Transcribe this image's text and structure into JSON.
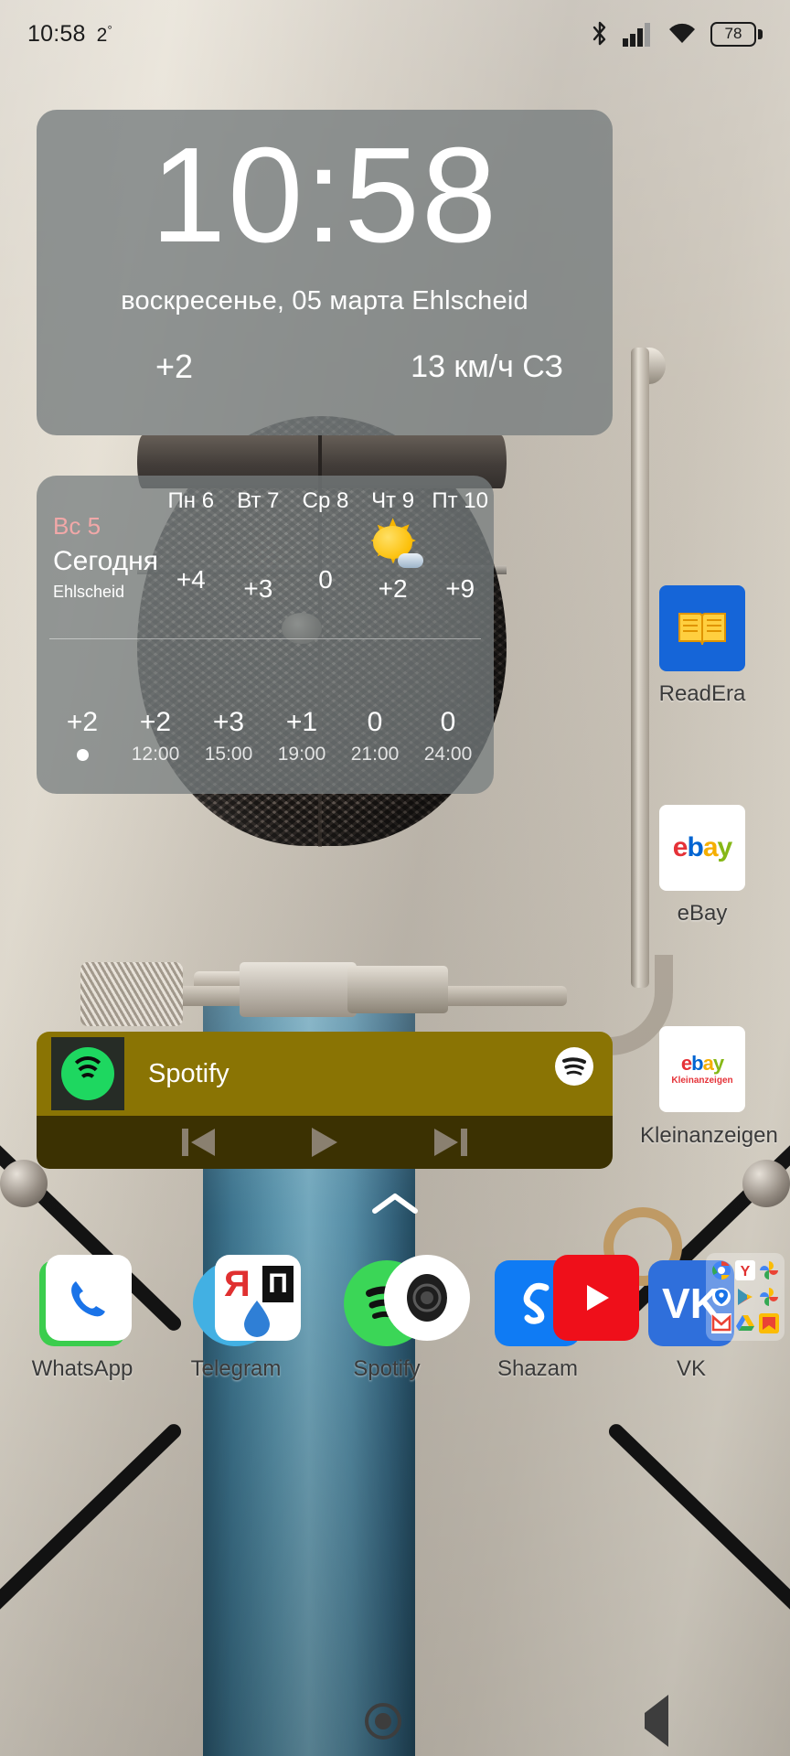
{
  "status_bar": {
    "time": "10:58",
    "temperature": "2",
    "degree": "°",
    "battery_level": "78",
    "icons": [
      "bluetooth-icon",
      "cellular-signal-icon",
      "wifi-icon",
      "battery-icon"
    ]
  },
  "clock_widget": {
    "time": "10:58",
    "date": "воскресенье, 05 марта Ehlscheid",
    "weather_icon": "rain-cloud-icon",
    "temperature": "+2",
    "wind": "13 км/ч СЗ"
  },
  "weather_widget": {
    "today_day": "Вс 5",
    "today_label": "Сегодня",
    "city": "Ehlscheid",
    "days": [
      {
        "label": "Пн 6",
        "icon": "cloud-icon",
        "temp": "+4"
      },
      {
        "label": "Вт 7",
        "icon": "rain-cloud-icon",
        "temp": "+3"
      },
      {
        "label": "Ср 8",
        "icon": "cloud-icon",
        "temp": "0"
      },
      {
        "label": "Чт 9",
        "icon": "sun-cloud-icon",
        "temp": "+2"
      },
      {
        "label": "Пт 10",
        "icon": "rain-cloud-icon",
        "temp": "+9"
      }
    ],
    "hours": [
      {
        "time": "",
        "icon": "rain-cloud-icon",
        "temp": "+2",
        "current": true
      },
      {
        "time": "12:00",
        "icon": "rain-cloud-icon",
        "temp": "+2",
        "current": false
      },
      {
        "time": "15:00",
        "icon": "rain-cloud-icon",
        "temp": "+3",
        "current": false
      },
      {
        "time": "19:00",
        "icon": "rain-cloud-icon",
        "temp": "+1",
        "current": false
      },
      {
        "time": "21:00",
        "icon": "cloud-icon",
        "temp": "0",
        "current": false
      },
      {
        "time": "24:00",
        "icon": "cloud-icon",
        "temp": "0",
        "current": false
      }
    ]
  },
  "spotify_widget": {
    "app_name": "Spotify",
    "album_art_icon": "spotify-icon",
    "badge_icon": "spotify-badge-icon",
    "controls": [
      {
        "name": "previous-track-button",
        "icon": "skip-previous-icon"
      },
      {
        "name": "play-button",
        "icon": "play-icon"
      },
      {
        "name": "next-track-button",
        "icon": "skip-next-icon"
      }
    ]
  },
  "right_column_apps": [
    {
      "label": "ReadEra",
      "icon": "readera-icon"
    },
    {
      "label": "eBay",
      "icon": "ebay-icon"
    },
    {
      "label": "Kleinanzeigen",
      "icon": "kleinanzeigen-icon"
    }
  ],
  "app_row": [
    {
      "label": "WhatsApp",
      "icon": "whatsapp-icon"
    },
    {
      "label": "Telegram",
      "icon": "telegram-icon"
    },
    {
      "label": "Spotify",
      "icon": "spotify-icon"
    },
    {
      "label": "Shazam",
      "icon": "shazam-icon"
    },
    {
      "label": "VK",
      "icon": "vk-icon"
    }
  ],
  "page_arrow": {
    "icon": "chevron-up-icon"
  },
  "dock": [
    {
      "name": "phone-app",
      "icon": "phone-icon"
    },
    {
      "name": "yandex-navigator-app",
      "icon": "yandex-navigator-icon"
    },
    {
      "name": "camera-app",
      "icon": "camera-icon"
    },
    {
      "name": "youtube-app",
      "icon": "youtube-icon"
    },
    {
      "name": "google-folder",
      "icon": "google-folder-icon"
    }
  ],
  "navigation_bar": [
    {
      "name": "recents-button",
      "icon": "recents-square-icon"
    },
    {
      "name": "home-button",
      "icon": "home-circle-icon"
    },
    {
      "name": "back-button",
      "icon": "back-triangle-icon"
    }
  ],
  "colors": {
    "widget_bg": "#787e80",
    "spotify_top": "#8a7404",
    "spotify_bottom": "#3b3102",
    "spotify_green": "#1ed760",
    "today_accent": "#f1a8a8",
    "status_text": "#1b1b1b"
  }
}
